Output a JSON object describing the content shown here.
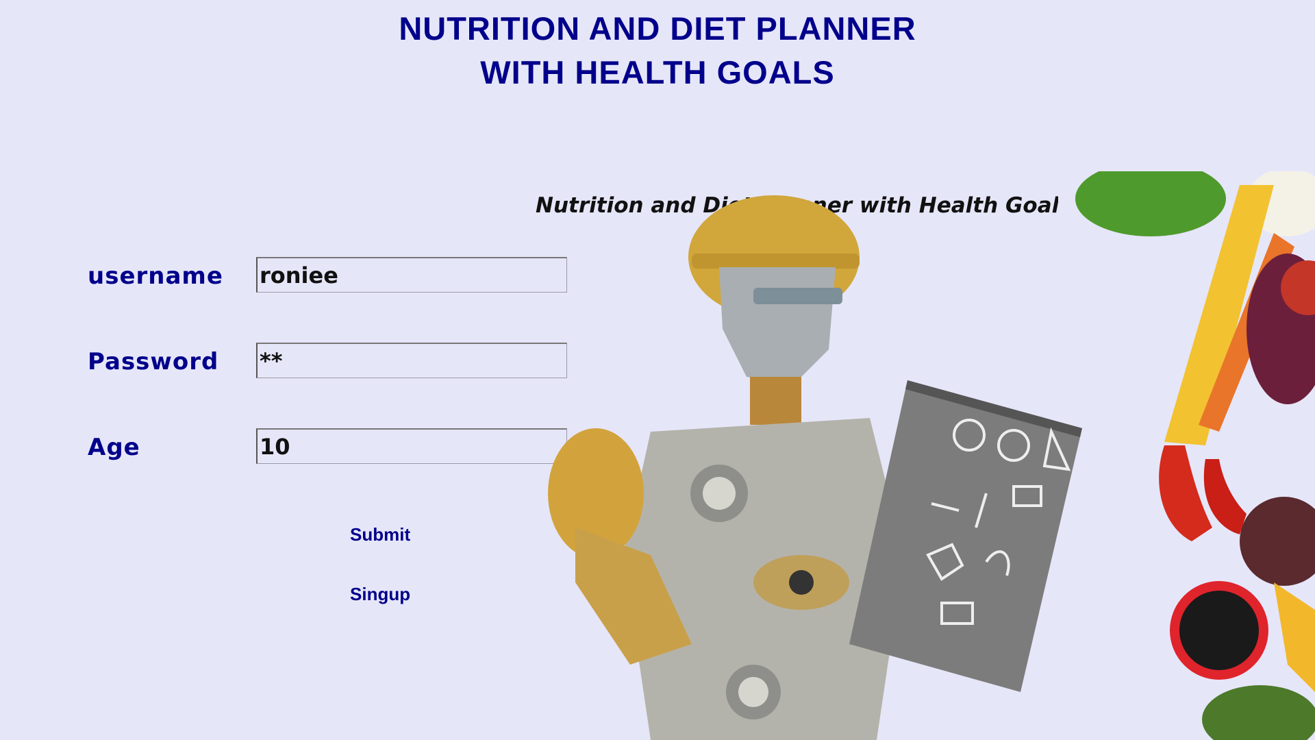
{
  "header": {
    "title_line1": "NUTRITION AND DIET PLANNER",
    "title_line2": "WITH HEALTH GOALS"
  },
  "form": {
    "username_label": "username",
    "username_value": "roniee",
    "password_label": "Password",
    "password_value": "**",
    "age_label": "Age",
    "age_value": "10",
    "submit_label": "Submit",
    "signup_label": "Singup"
  },
  "banner": {
    "text": "Nutrition and Diet Planner with Health Goals"
  },
  "colors": {
    "background": "#e6e6f9",
    "accent": "#00008b"
  },
  "illustration": {
    "icons": [
      "robot-icon",
      "clipboard-icon",
      "vegetables-icon"
    ]
  }
}
